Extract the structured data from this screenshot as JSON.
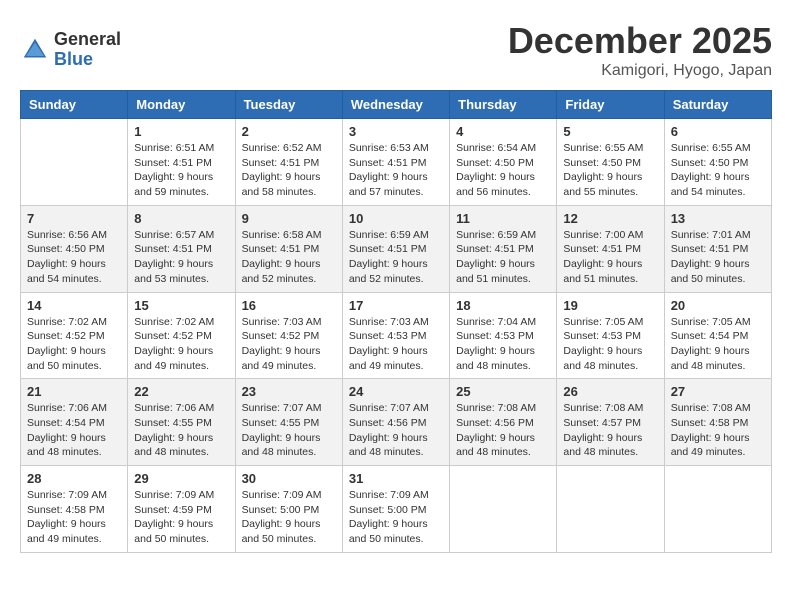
{
  "header": {
    "logo_general": "General",
    "logo_blue": "Blue",
    "month_title": "December 2025",
    "location": "Kamigori, Hyogo, Japan"
  },
  "weekdays": [
    "Sunday",
    "Monday",
    "Tuesday",
    "Wednesday",
    "Thursday",
    "Friday",
    "Saturday"
  ],
  "weeks": [
    [
      {
        "day": "",
        "info": ""
      },
      {
        "day": "1",
        "info": "Sunrise: 6:51 AM\nSunset: 4:51 PM\nDaylight: 9 hours\nand 59 minutes."
      },
      {
        "day": "2",
        "info": "Sunrise: 6:52 AM\nSunset: 4:51 PM\nDaylight: 9 hours\nand 58 minutes."
      },
      {
        "day": "3",
        "info": "Sunrise: 6:53 AM\nSunset: 4:51 PM\nDaylight: 9 hours\nand 57 minutes."
      },
      {
        "day": "4",
        "info": "Sunrise: 6:54 AM\nSunset: 4:50 PM\nDaylight: 9 hours\nand 56 minutes."
      },
      {
        "day": "5",
        "info": "Sunrise: 6:55 AM\nSunset: 4:50 PM\nDaylight: 9 hours\nand 55 minutes."
      },
      {
        "day": "6",
        "info": "Sunrise: 6:55 AM\nSunset: 4:50 PM\nDaylight: 9 hours\nand 54 minutes."
      }
    ],
    [
      {
        "day": "7",
        "info": "Sunrise: 6:56 AM\nSunset: 4:50 PM\nDaylight: 9 hours\nand 54 minutes."
      },
      {
        "day": "8",
        "info": "Sunrise: 6:57 AM\nSunset: 4:51 PM\nDaylight: 9 hours\nand 53 minutes."
      },
      {
        "day": "9",
        "info": "Sunrise: 6:58 AM\nSunset: 4:51 PM\nDaylight: 9 hours\nand 52 minutes."
      },
      {
        "day": "10",
        "info": "Sunrise: 6:59 AM\nSunset: 4:51 PM\nDaylight: 9 hours\nand 52 minutes."
      },
      {
        "day": "11",
        "info": "Sunrise: 6:59 AM\nSunset: 4:51 PM\nDaylight: 9 hours\nand 51 minutes."
      },
      {
        "day": "12",
        "info": "Sunrise: 7:00 AM\nSunset: 4:51 PM\nDaylight: 9 hours\nand 51 minutes."
      },
      {
        "day": "13",
        "info": "Sunrise: 7:01 AM\nSunset: 4:51 PM\nDaylight: 9 hours\nand 50 minutes."
      }
    ],
    [
      {
        "day": "14",
        "info": "Sunrise: 7:02 AM\nSunset: 4:52 PM\nDaylight: 9 hours\nand 50 minutes."
      },
      {
        "day": "15",
        "info": "Sunrise: 7:02 AM\nSunset: 4:52 PM\nDaylight: 9 hours\nand 49 minutes."
      },
      {
        "day": "16",
        "info": "Sunrise: 7:03 AM\nSunset: 4:52 PM\nDaylight: 9 hours\nand 49 minutes."
      },
      {
        "day": "17",
        "info": "Sunrise: 7:03 AM\nSunset: 4:53 PM\nDaylight: 9 hours\nand 49 minutes."
      },
      {
        "day": "18",
        "info": "Sunrise: 7:04 AM\nSunset: 4:53 PM\nDaylight: 9 hours\nand 48 minutes."
      },
      {
        "day": "19",
        "info": "Sunrise: 7:05 AM\nSunset: 4:53 PM\nDaylight: 9 hours\nand 48 minutes."
      },
      {
        "day": "20",
        "info": "Sunrise: 7:05 AM\nSunset: 4:54 PM\nDaylight: 9 hours\nand 48 minutes."
      }
    ],
    [
      {
        "day": "21",
        "info": "Sunrise: 7:06 AM\nSunset: 4:54 PM\nDaylight: 9 hours\nand 48 minutes."
      },
      {
        "day": "22",
        "info": "Sunrise: 7:06 AM\nSunset: 4:55 PM\nDaylight: 9 hours\nand 48 minutes."
      },
      {
        "day": "23",
        "info": "Sunrise: 7:07 AM\nSunset: 4:55 PM\nDaylight: 9 hours\nand 48 minutes."
      },
      {
        "day": "24",
        "info": "Sunrise: 7:07 AM\nSunset: 4:56 PM\nDaylight: 9 hours\nand 48 minutes."
      },
      {
        "day": "25",
        "info": "Sunrise: 7:08 AM\nSunset: 4:56 PM\nDaylight: 9 hours\nand 48 minutes."
      },
      {
        "day": "26",
        "info": "Sunrise: 7:08 AM\nSunset: 4:57 PM\nDaylight: 9 hours\nand 48 minutes."
      },
      {
        "day": "27",
        "info": "Sunrise: 7:08 AM\nSunset: 4:58 PM\nDaylight: 9 hours\nand 49 minutes."
      }
    ],
    [
      {
        "day": "28",
        "info": "Sunrise: 7:09 AM\nSunset: 4:58 PM\nDaylight: 9 hours\nand 49 minutes."
      },
      {
        "day": "29",
        "info": "Sunrise: 7:09 AM\nSunset: 4:59 PM\nDaylight: 9 hours\nand 50 minutes."
      },
      {
        "day": "30",
        "info": "Sunrise: 7:09 AM\nSunset: 5:00 PM\nDaylight: 9 hours\nand 50 minutes."
      },
      {
        "day": "31",
        "info": "Sunrise: 7:09 AM\nSunset: 5:00 PM\nDaylight: 9 hours\nand 50 minutes."
      },
      {
        "day": "",
        "info": ""
      },
      {
        "day": "",
        "info": ""
      },
      {
        "day": "",
        "info": ""
      }
    ]
  ]
}
